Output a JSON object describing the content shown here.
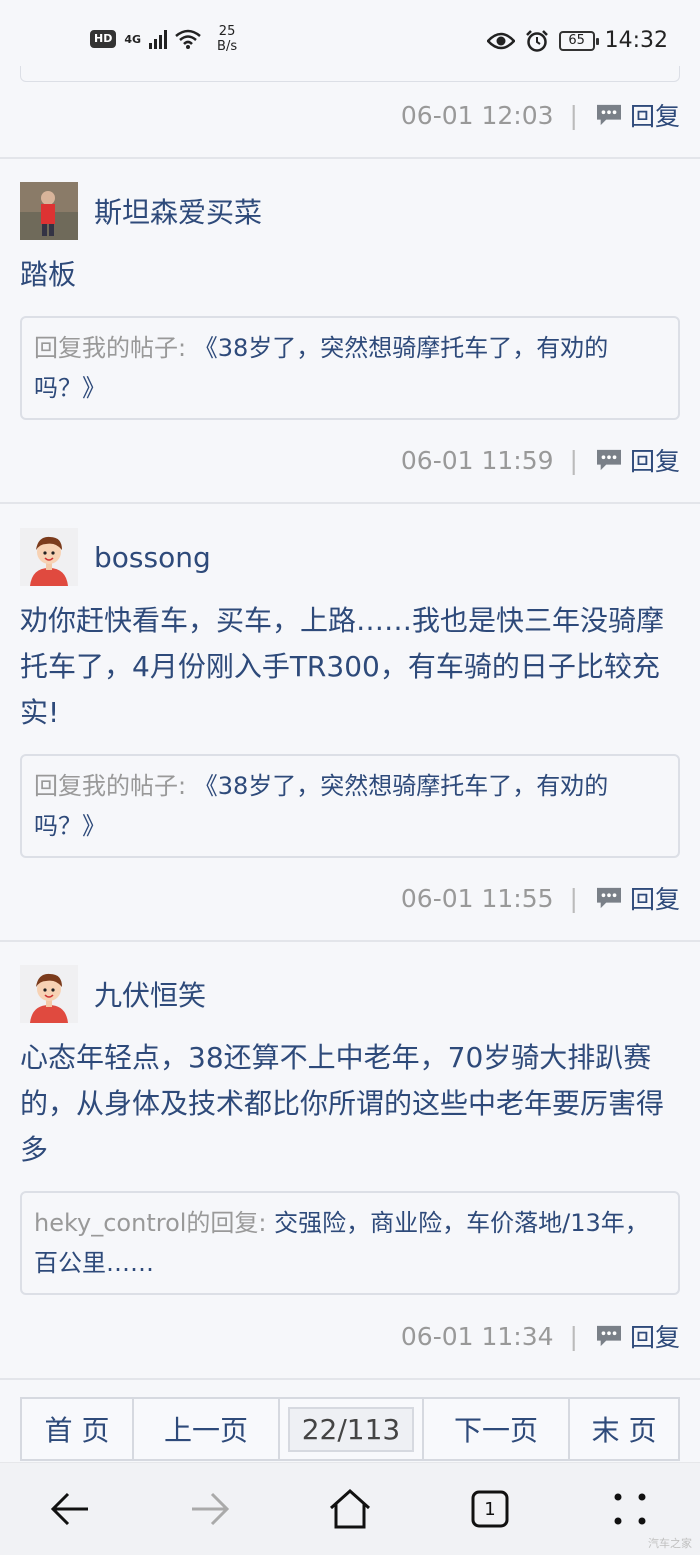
{
  "status_bar": {
    "hd": "HD",
    "network": "4G",
    "speed_value": "25",
    "speed_unit": "B/s",
    "battery": "65",
    "time": "14:32"
  },
  "reply_label": "回复",
  "posts": [
    {
      "time": "06-01 12:03"
    },
    {
      "username": "斯坦森爱买菜",
      "content": "踏板",
      "quote_label": "回复我的帖子:",
      "quote_text": "《38岁了，突然想骑摩托车了，有劝的吗？》",
      "time": "06-01 11:59"
    },
    {
      "username": "bossong",
      "content": "劝你赶快看车，买车，上路……我也是快三年没骑摩托车了，4月份刚入手TR300，有车骑的日子比较充实!",
      "quote_label": "回复我的帖子:",
      "quote_text": "《38岁了，突然想骑摩托车了，有劝的吗？》",
      "time": "06-01 11:55"
    },
    {
      "username": "九伏恒笑",
      "content": "心态年轻点，38还算不上中老年，70岁骑大排趴赛的，从身体及技术都比你所谓的这些中老年要厉害得多",
      "quote_label": "heky_control的回复:",
      "quote_text": "交强险，商业险，车价落地/13年，百公里……",
      "time": "06-01 11:34"
    }
  ],
  "pager": {
    "first": "首 页",
    "prev": "上一页",
    "current": "22/113",
    "next": "下一页",
    "last": "末 页"
  },
  "nav": {
    "tab_count": "1"
  },
  "watermark": "汽车之家",
  "colors": {
    "link": "#2e4a7a",
    "muted": "#999999",
    "background": "#f6f7fa"
  }
}
